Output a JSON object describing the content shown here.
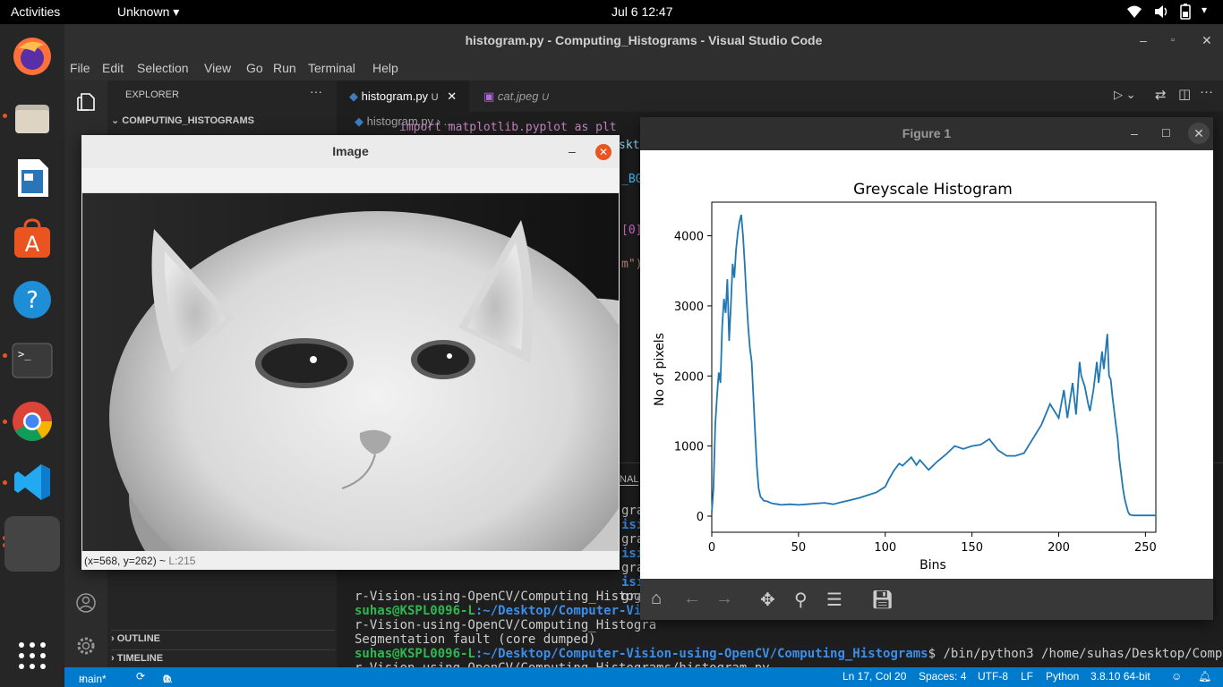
{
  "topbar": {
    "activities": "Activities",
    "app_menu": "Unknown",
    "clock": "Jul 6  12:47"
  },
  "vscode": {
    "title": "histogram.py - Computing_Histograms - Visual Studio Code",
    "menu": [
      "File",
      "Edit",
      "Selection",
      "View",
      "Go",
      "Run",
      "Terminal",
      "Help"
    ],
    "sidebar": {
      "header": "EXPLORER",
      "more": "···",
      "project": "COMPUTING_HISTOGRAMS",
      "outline": "OUTLINE",
      "timeline": "TIMELINE"
    },
    "tabs": [
      {
        "label": "histogram.py",
        "badge": "U"
      },
      {
        "label": "cat.jpeg",
        "badge": "U"
      }
    ],
    "breadcrumb": [
      "histogram.py",
      "..."
    ],
    "editor_fragments": {
      "line1": "import matplotlib.pyplot as plt",
      "frag1": "skt",
      "frag2": "_BG",
      "frag3": "[0]",
      "frag4": "m\")"
    },
    "panel": {
      "tab_fragment": "INAL",
      "left_fragments": [
        "gra",
        "isi",
        "gra",
        "isi",
        "gra",
        "isi",
        "gra"
      ],
      "lines": [
        {
          "text": "r-Vision-using-OpenCV/Computing_Histogra"
        },
        {
          "user": "suhas@KSPL0096-L",
          "path": ":~/Desktop/Computer-Visi",
          "rest": ""
        },
        {
          "text": "r-Vision-using-OpenCV/Computing_Histogra"
        },
        {
          "text": "Segmentation fault (core dumped)"
        },
        {
          "user": "suhas@KSPL0096-L",
          "path": ":~/Desktop/Computer-Vision-using-OpenCV/Computing_Histograms",
          "rest": "$ /bin/python3 /home/suhas/Desktop/Compute"
        },
        {
          "text": "r-Vision-using-OpenCV/Computing_Histograms/histogram.py"
        }
      ]
    },
    "statusbar": {
      "branch": "main*",
      "errors": "0",
      "warnings": "0",
      "position": "Ln 17, Col 20",
      "spaces": "Spaces: 4",
      "encoding": "UTF-8",
      "eol": "LF",
      "language": "Python",
      "interpreter": "3.8.10 64-bit"
    }
  },
  "image_window": {
    "title": "Image",
    "status": "(x=568, y=262) ~",
    "status_value": "L:215"
  },
  "figure_window": {
    "title": "Figure 1"
  },
  "chart_data": {
    "type": "line",
    "title": "Greyscale Histogram",
    "xlabel": "Bins",
    "ylabel": "No of pixels",
    "xlim": [
      0,
      256
    ],
    "ylim": [
      -230,
      4480
    ],
    "xticks": [
      0,
      50,
      100,
      150,
      200,
      250
    ],
    "yticks": [
      0,
      1000,
      2000,
      3000,
      4000
    ],
    "color": "#1f77b4",
    "series": [
      {
        "x": [
          0,
          1,
          2,
          3,
          4,
          5,
          6,
          7,
          8,
          9,
          10,
          11,
          12,
          13,
          14,
          15,
          16,
          17,
          18,
          19,
          20,
          21,
          22,
          23,
          24,
          25,
          26,
          27,
          28,
          29,
          30,
          32,
          35,
          38,
          40,
          45,
          50,
          55,
          60,
          65,
          70,
          75,
          80,
          85,
          90,
          95,
          100,
          102,
          105,
          108,
          110,
          115,
          118,
          120,
          125,
          130,
          135,
          140,
          145,
          150,
          155,
          160,
          165,
          170,
          175,
          180,
          185,
          190,
          195,
          200,
          203,
          205,
          208,
          210,
          212,
          213,
          215,
          217,
          218,
          220,
          222,
          223,
          225,
          226,
          228,
          229,
          230,
          231,
          232,
          233,
          234,
          235,
          236,
          237,
          238,
          239,
          240,
          241,
          242,
          243,
          245,
          247,
          250,
          252,
          256
        ],
        "values": [
          50,
          400,
          1300,
          1700,
          2050,
          1900,
          2700,
          3100,
          2900,
          3380,
          2500,
          3000,
          3600,
          3400,
          3800,
          4050,
          4200,
          4300,
          4000,
          3600,
          3100,
          2700,
          2400,
          2200,
          1700,
          1200,
          700,
          400,
          280,
          250,
          220,
          210,
          180,
          170,
          160,
          170,
          160,
          170,
          180,
          190,
          170,
          200,
          230,
          260,
          300,
          340,
          420,
          520,
          650,
          750,
          720,
          840,
          730,
          800,
          660,
          780,
          880,
          1000,
          960,
          1000,
          1020,
          1100,
          940,
          860,
          860,
          900,
          1100,
          1300,
          1600,
          1400,
          1800,
          1400,
          1900,
          1450,
          2200,
          2000,
          1850,
          1600,
          1500,
          1800,
          2200,
          1900,
          2350,
          2100,
          2600,
          2000,
          1950,
          1700,
          1500,
          1300,
          1100,
          800,
          600,
          400,
          250,
          150,
          60,
          20,
          15,
          10,
          10,
          10,
          10,
          10,
          10
        ]
      }
    ]
  }
}
